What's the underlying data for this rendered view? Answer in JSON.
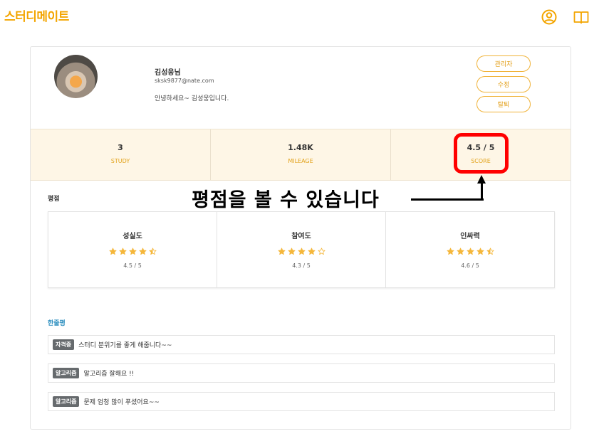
{
  "header": {
    "logo": "스터디메이트",
    "icons": [
      "user-circle-icon",
      "book-icon"
    ]
  },
  "profile": {
    "name": "김성웅님",
    "email": "sksk9877@nate.com",
    "intro": "안녕하세요~ 김성웅입니다."
  },
  "actions": {
    "admin": "관리자",
    "edit": "수정",
    "withdraw": "탈퇴"
  },
  "stats": [
    {
      "value": "3",
      "label": "STUDY"
    },
    {
      "value": "1.48K",
      "label": "MILEAGE"
    },
    {
      "value": "4.5 / 5",
      "label": "SCORE"
    }
  ],
  "annotation": {
    "text": "평점을 볼 수 있습니다",
    "color": "#ff0000"
  },
  "ratings_section": {
    "title": "평점",
    "items": [
      {
        "name": "성실도",
        "score": "4.5 / 5",
        "stars": 4.5
      },
      {
        "name": "참여도",
        "score": "4.3 / 5",
        "stars": 4
      },
      {
        "name": "인싸력",
        "score": "4.6 / 5",
        "stars": 4.5
      }
    ]
  },
  "comments_section": {
    "title": "한줄평",
    "items": [
      {
        "tag": "자격증",
        "text": "스터디 분위기를 좋게 해줍니다~~"
      },
      {
        "tag": "알고리즘",
        "text": "알고리즘 잘해요 !!"
      },
      {
        "tag": "알고리즘",
        "text": "문제 엄청 많이 푸셨어요~~"
      }
    ]
  },
  "colors": {
    "accent": "#f3a500",
    "stats_bg": "#fef6e6",
    "star": "#f5b73b",
    "comment_title": "#2d8fbf",
    "tag_bg": "#666a6d"
  }
}
